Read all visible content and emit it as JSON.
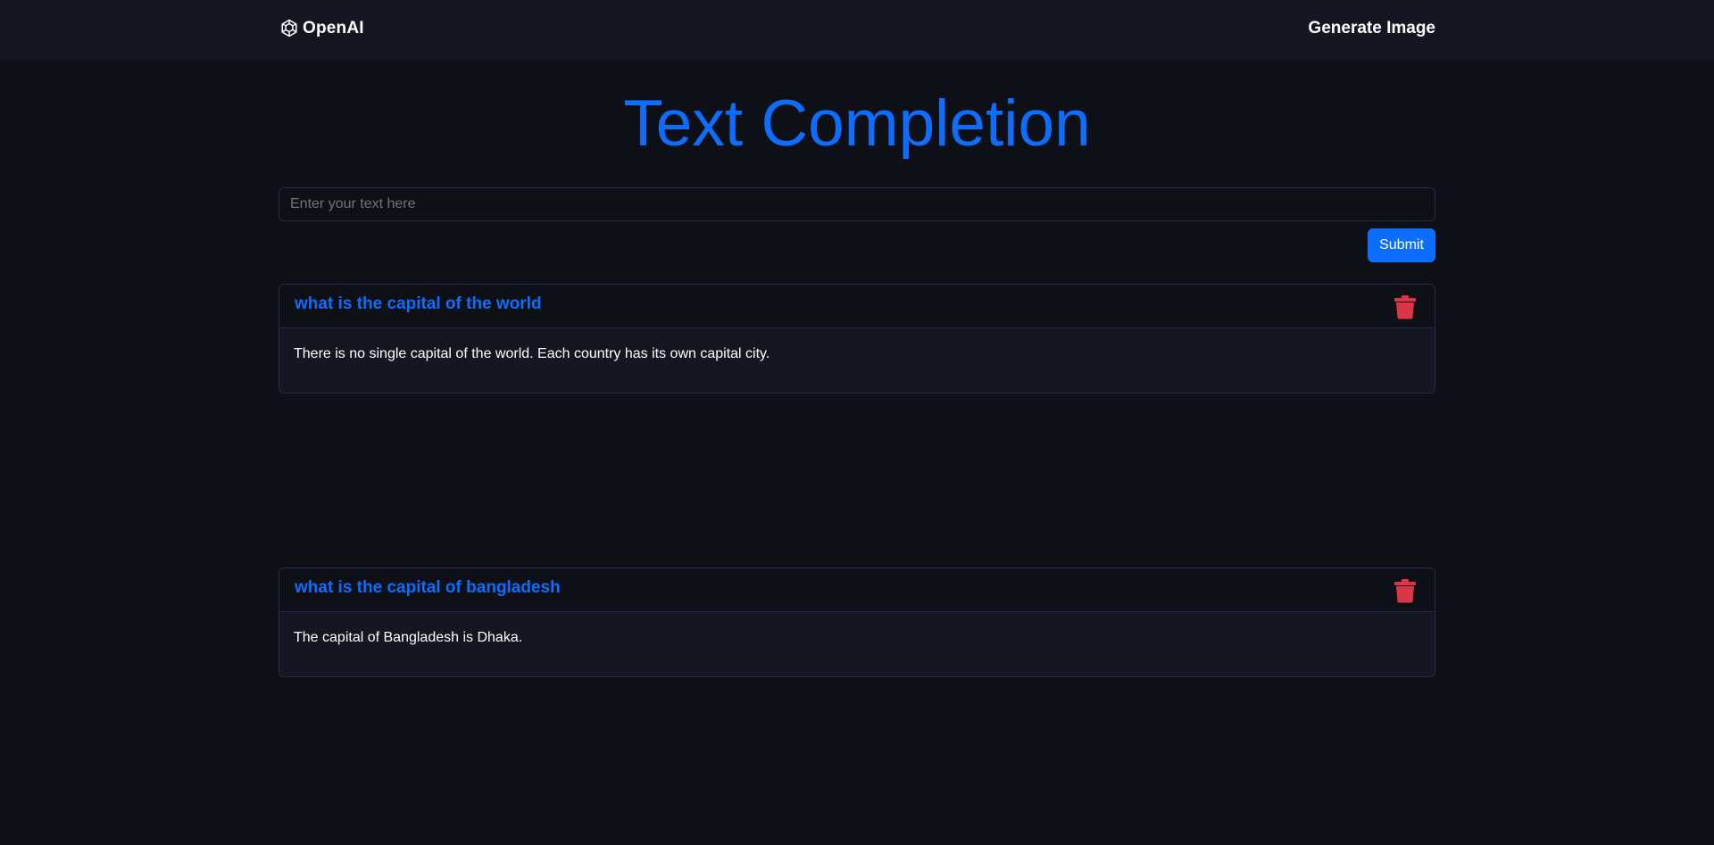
{
  "nav": {
    "brand": "OpenAI",
    "brand_icon": "openai-logo-icon",
    "link": "Generate Image"
  },
  "main": {
    "title": "Text Completion",
    "input": {
      "placeholder": "Enter your text here",
      "value": ""
    },
    "submit_label": "Submit"
  },
  "results": [
    {
      "question": "what is the capital of the world",
      "answer": "There is no single capital of the world. Each country has its own capital city.",
      "delete_icon": "trash-icon"
    },
    {
      "question": "what is the capital of bangladesh",
      "answer": "The capital of Bangladesh is Dhaka.",
      "delete_icon": "trash-icon"
    }
  ],
  "colors": {
    "background": "#0d1017",
    "navbar": "#131722",
    "accent": "#0d6efd",
    "danger": "#dc3545",
    "border": "#1b2d52"
  }
}
